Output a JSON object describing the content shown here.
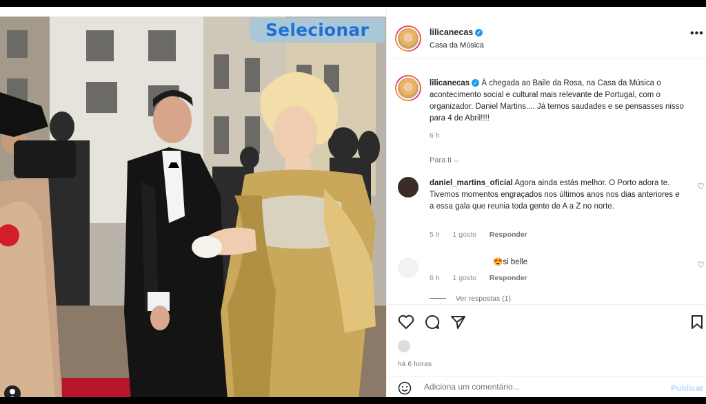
{
  "overlay": {
    "select_label": "Selecionar"
  },
  "post": {
    "username": "lilicanecas",
    "location": "Casa da Música",
    "more": "•••"
  },
  "caption": {
    "username": "lilicanecas",
    "text": "À chegada ao Baile da Rosa, na Casa da Música o acontecimento social e cultural mais relevante de Portugal, com o organizador. Daniel Martins.... Já temos saudades e se pensasses nisso para 4 de Abril!!!!",
    "time": "6 h",
    "see_translation": "Para ti"
  },
  "comments": [
    {
      "username": "daniel_martins_oficial",
      "text": "Agora ainda estás melhor. O Porto adora te. Tivemos momentos engraçados nos últimos anos nos dias anteriores e a essa gala que reunia toda gente de A a Z no norte.",
      "time": "5 h",
      "likes": "1 gosto",
      "reply": "Responder"
    },
    {
      "username": "",
      "text": "si belle",
      "time": "6 h",
      "likes": "1 gosto",
      "reply": "Responder",
      "view_replies": "Ver respostas (1)"
    }
  ],
  "footer": {
    "time_ago": "há 6 horas",
    "comment_placeholder": "Adiciona um comentário...",
    "publish": "Publicar"
  },
  "icons": [
    "heart-icon",
    "comment-icon",
    "share-icon",
    "bookmark-icon",
    "emoji-icon",
    "more-icon",
    "verified-icon",
    "user-tag-icon"
  ],
  "colors": {
    "verified": "#1d9bf0",
    "publish_disabled": "#b3dbff",
    "overlay_text": "#1f6fd6"
  }
}
